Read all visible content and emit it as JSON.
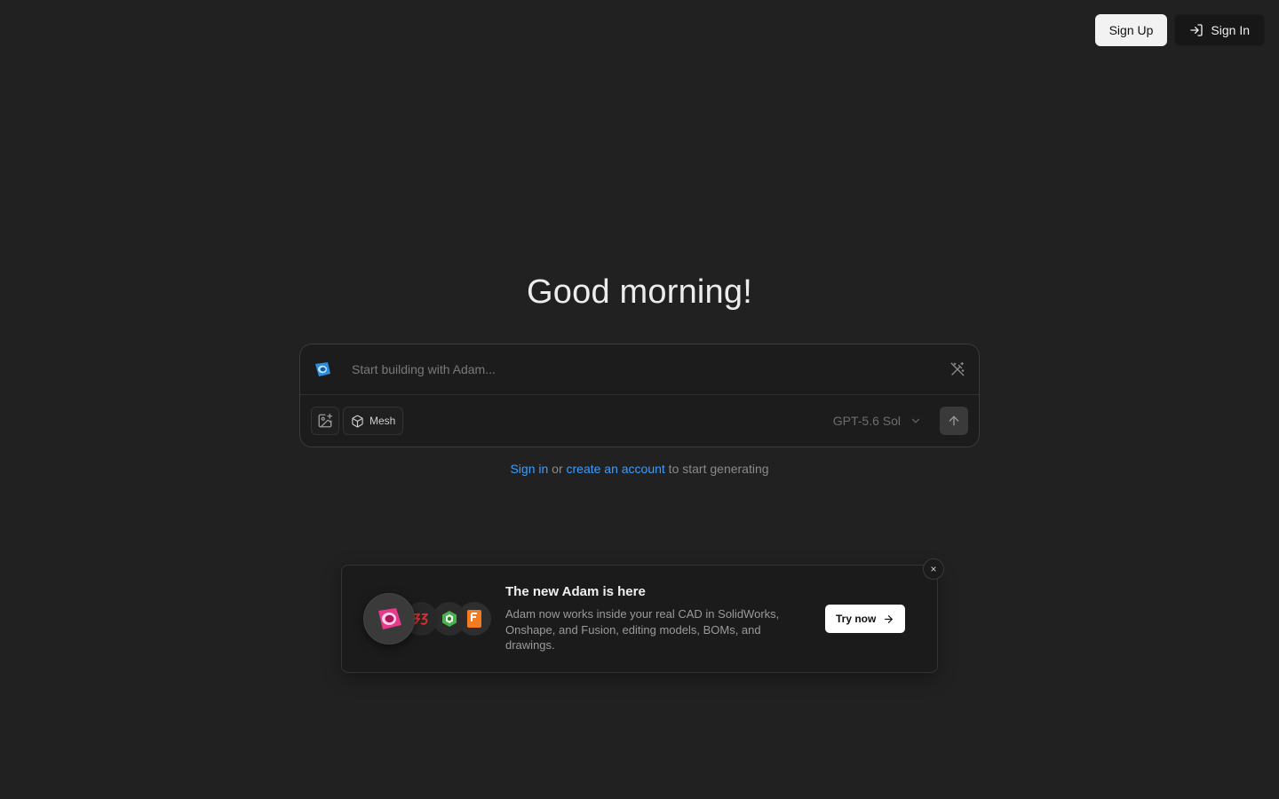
{
  "header": {
    "sign_up_label": "Sign Up",
    "sign_in_label": "Sign In"
  },
  "main": {
    "greeting": "Good morning!"
  },
  "composer": {
    "placeholder": "Start building with Adam...",
    "mesh_label": "Mesh",
    "model_label": "GPT-5.6 Sol"
  },
  "auth_hint": {
    "sign_in_link": "Sign in",
    "or_text": " or ",
    "create_link": "create an account",
    "suffix": " to start generating"
  },
  "promo": {
    "title": "The new Adam is here",
    "description": "Adam now works inside your real CAD in SolidWorks, Onshape, and Fusion, editing models, BOMs, and drawings.",
    "try_label": "Try now",
    "close_glyph": "×"
  },
  "icons": {
    "sign_in": "sign-in-icon",
    "logo": "adam-logo-icon",
    "wand": "magic-wand-icon",
    "image": "image-add-icon",
    "mesh": "cube-icon",
    "chevron": "chevron-down-icon",
    "send": "arrow-up-icon",
    "arrow_right": "arrow-right-icon"
  },
  "colors": {
    "background": "#212121",
    "link": "#3b9eff",
    "adam_pink": "#e8398c",
    "solidworks_red": "#d32f2f",
    "onshape_green": "#4caf50",
    "fusion_orange": "#f47c20"
  }
}
